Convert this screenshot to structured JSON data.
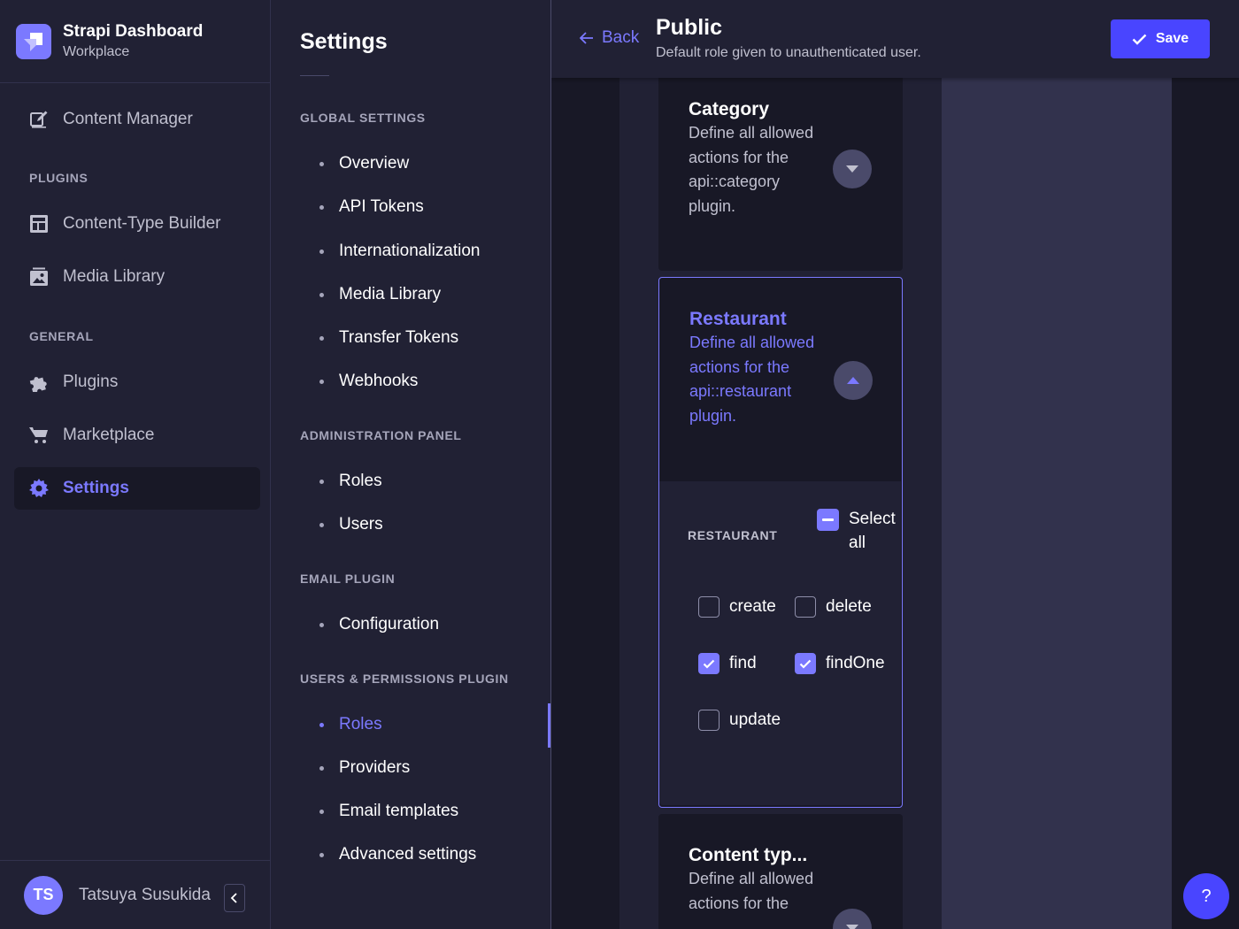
{
  "brand": {
    "title": "Strapi Dashboard",
    "subtitle": "Workplace"
  },
  "leftnav": {
    "content_manager": "Content Manager",
    "plugins_section": "PLUGINS",
    "content_type_builder": "Content-Type Builder",
    "media_library": "Media Library",
    "general_section": "GENERAL",
    "plugins": "Plugins",
    "marketplace": "Marketplace",
    "settings": "Settings"
  },
  "user": {
    "initials": "TS",
    "name": "Tatsuya Susukida"
  },
  "subnav": {
    "title": "Settings",
    "global_section": "GLOBAL SETTINGS",
    "global_items": [
      "Overview",
      "API Tokens",
      "Internationalization",
      "Media Library",
      "Transfer Tokens",
      "Webhooks"
    ],
    "admin_section": "ADMINISTRATION PANEL",
    "admin_items": [
      "Roles",
      "Users"
    ],
    "email_section": "EMAIL PLUGIN",
    "email_items": [
      "Configuration"
    ],
    "up_section": "USERS & PERMISSIONS PLUGIN",
    "up_items": [
      "Roles",
      "Providers",
      "Email templates",
      "Advanced settings"
    ],
    "active_item": "Roles"
  },
  "header": {
    "back": "Back",
    "title": "Public",
    "subtitle": "Default role given to unauthenticated user.",
    "save": "Save"
  },
  "accordions": {
    "category": {
      "title": "Category",
      "description": "Define all allowed actions for the api::category plugin.",
      "expanded": false
    },
    "restaurant": {
      "title": "Restaurant",
      "description": "Define all allowed actions for the api::restaurant plugin.",
      "expanded": true
    },
    "content_type": {
      "title": "Content typ...",
      "description": "Define all allowed actions for the",
      "expanded": false
    }
  },
  "permissions": {
    "heading": "RESTAURANT",
    "select_all": "Select all",
    "select_all_state": "indeterminate",
    "actions": [
      {
        "label": "create",
        "checked": false
      },
      {
        "label": "delete",
        "checked": false
      },
      {
        "label": "find",
        "checked": true
      },
      {
        "label": "findOne",
        "checked": true
      },
      {
        "label": "update",
        "checked": false
      }
    ]
  },
  "help": {
    "label": "?"
  },
  "colors": {
    "accent": "#7b79ff",
    "primary": "#4945ff",
    "background": "#181826",
    "panel": "#212134"
  }
}
